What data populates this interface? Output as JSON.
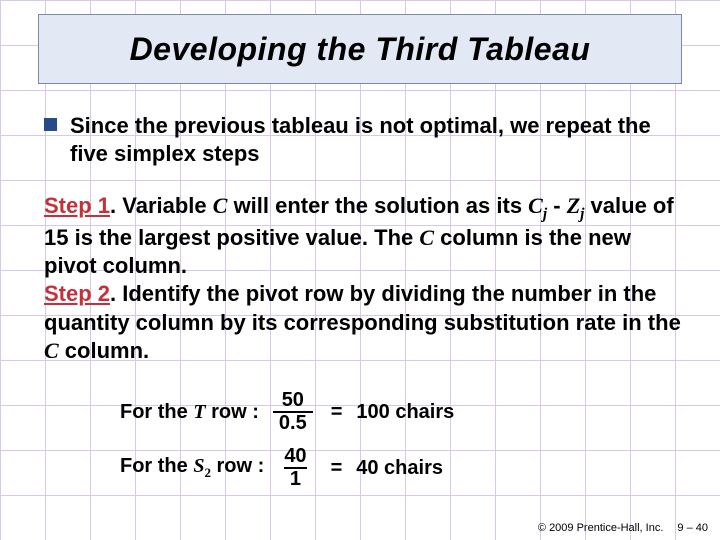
{
  "title": "Developing the Third Tableau",
  "bullet": {
    "pre": "Since the previous tableau is ",
    "emph": "not optimal",
    "post": ", we repeat the five simplex steps"
  },
  "step1": {
    "label": "Step 1",
    "sep": ". Variable ",
    "var1": "C",
    "mid1": " will enter the solution as its ",
    "cj_c": "C",
    "cj_j": "j",
    "dash": " - ",
    "zj_z": "Z",
    "zj_j": "j",
    "mid2": " value of 15 is the largest positive value. The ",
    "var2": "C",
    "tail": " column is the new pivot column."
  },
  "step2": {
    "label": "Step 2",
    "sep": ". Identify the pivot row by dividing the number in the quantity column by its corresponding substitution rate in the ",
    "var": "C",
    "tail": " column."
  },
  "math": {
    "row1": {
      "prefix": "For the ",
      "sym": "T",
      "suffix": " row :",
      "num": "50",
      "den": "0.5",
      "eq": "=",
      "res": "100 chairs"
    },
    "row2": {
      "prefix": "For the ",
      "sym": "S",
      "sub": "2",
      "suffix": " row :",
      "num": "40",
      "den": "1",
      "eq": "=",
      "res": "40 chairs"
    }
  },
  "footer": {
    "copyright": "© 2009 Prentice-Hall, Inc.",
    "page": "9 – 40"
  }
}
